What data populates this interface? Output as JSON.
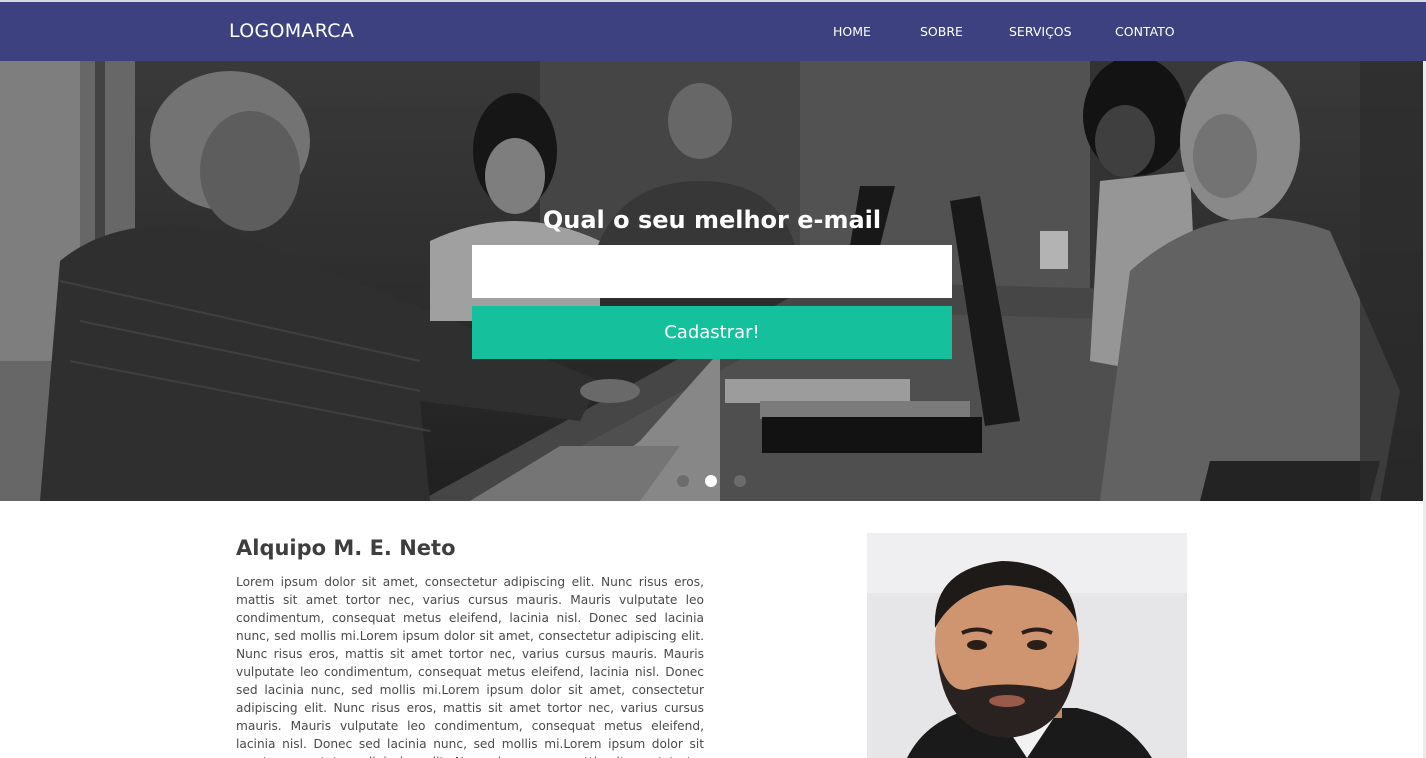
{
  "header": {
    "logo": "LOGOMARCA",
    "nav": [
      "HOME",
      "SOBRE",
      "SERVIÇOS",
      "CONTATO"
    ]
  },
  "hero": {
    "headline": "Qual o seu melhor e-mail",
    "email_value": "",
    "button_label": "Cadastrar!",
    "slides": 3,
    "active_slide": 2
  },
  "about": {
    "title": "Alquipo M. E. Neto",
    "text": "Lorem ipsum dolor sit amet, consectetur adipiscing elit. Nunc risus eros, mattis sit amet tortor nec, varius cursus mauris. Mauris vulputate leo condimentum, consequat metus eleifend, lacinia nisl. Donec sed lacinia nunc, sed mollis mi.Lorem ipsum dolor sit amet, consectetur adipiscing elit. Nunc risus eros, mattis sit amet tortor nec, varius cursus mauris. Mauris vulputate leo condimentum, consequat metus eleifend, lacinia nisl. Donec sed lacinia nunc, sed mollis mi.Lorem ipsum dolor sit amet, consectetur adipiscing elit. Nunc risus eros, mattis sit amet tortor nec, varius cursus mauris. Mauris vulputate leo condimentum, consequat metus eleifend, lacinia nisl. Donec sed lacinia nunc, sed mollis mi.Lorem ipsum dolor sit amet, consectetur adipiscing elit. Nunc risus eros, mattis sit amet tortor nec, varius cursus mauris."
  },
  "colors": {
    "navbar": "#3e4180",
    "button": "#14c19c"
  }
}
